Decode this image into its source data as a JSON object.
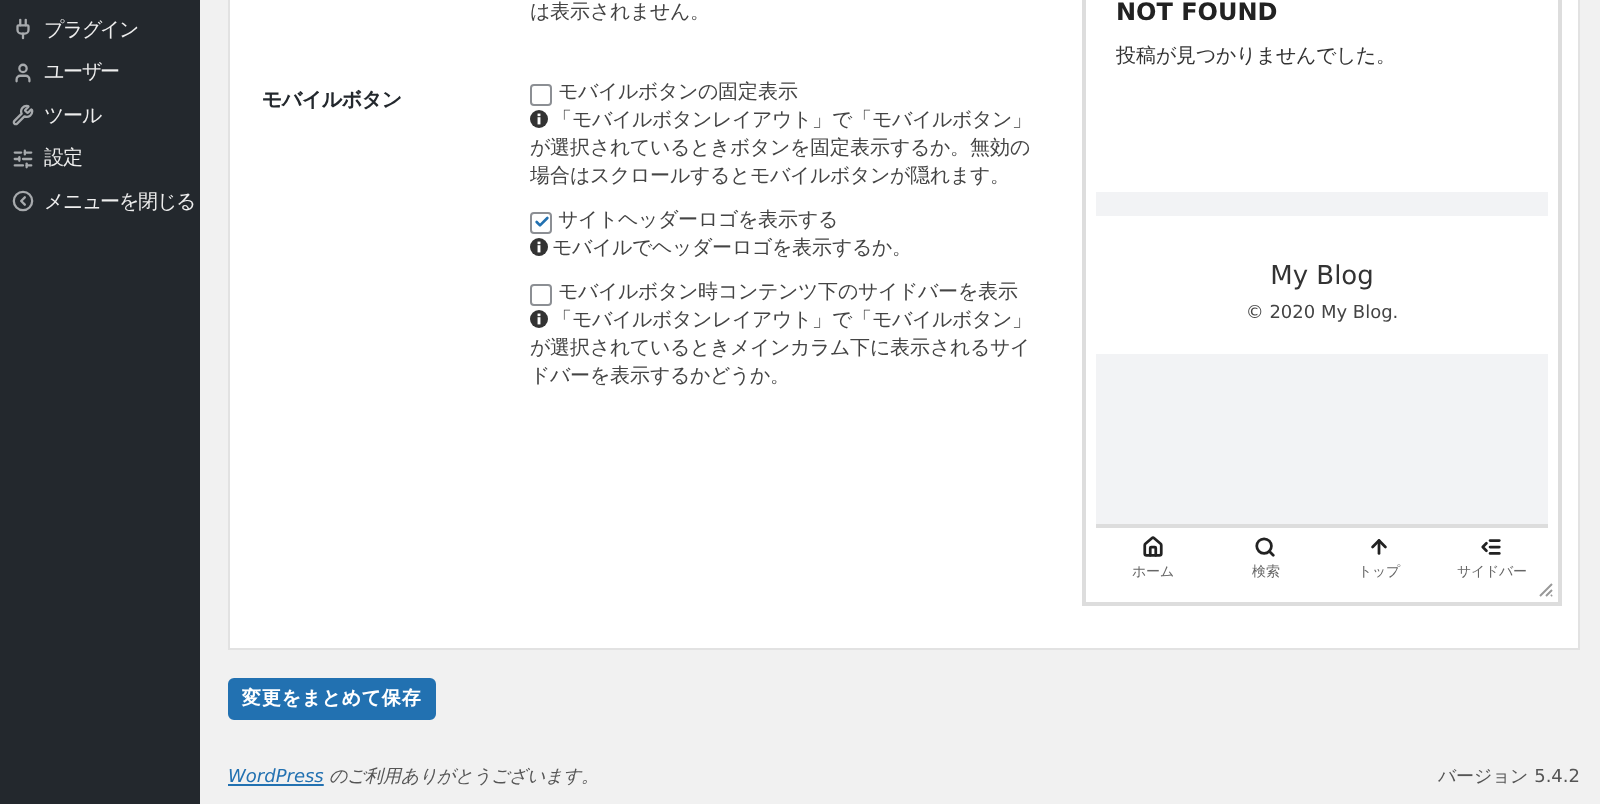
{
  "sidebar": {
    "items": [
      {
        "kind": "plugin",
        "label": "プラグイン"
      },
      {
        "kind": "user",
        "label": "ユーザー"
      },
      {
        "kind": "tool",
        "label": "ツール"
      },
      {
        "kind": "settings",
        "label": "設定"
      },
      {
        "kind": "collapse",
        "label": "メニューを閉じる"
      }
    ]
  },
  "settings": {
    "previous_note": "は表示されません。",
    "label": "モバイルボタン",
    "options": [
      {
        "label": "モバイルボタンの固定表示",
        "checked": false,
        "help": "「モバイルボタンレイアウト」で「モバイルボタン」が選択されているときボタンを固定表示するか。無効の場合はスクロールするとモバイルボタンが隠れます。"
      },
      {
        "label": "サイトヘッダーロゴを表示する",
        "checked": true,
        "help": "モバイルでヘッダーロゴを表示するか。"
      },
      {
        "label": "モバイルボタン時コンテンツ下のサイドバーを表示",
        "checked": false,
        "help": "「モバイルボタンレイアウト」で「モバイルボタン」が選択されているときメインカラム下に表示されるサイドバーを表示するかどうか。"
      }
    ]
  },
  "preview": {
    "heading": "NOT FOUND",
    "message": "投稿が見つかりませんでした。",
    "site_title": "My Blog",
    "copyright": "© 2020 My Blog.",
    "nav": [
      {
        "kind": "home",
        "label": "ホーム"
      },
      {
        "kind": "search",
        "label": "検索"
      },
      {
        "kind": "top",
        "label": "トップ"
      },
      {
        "kind": "sidebar",
        "label": "サイドバー"
      }
    ]
  },
  "save_button": "変更をまとめて保存",
  "footer": {
    "link": "WordPress",
    "thanks": " のご利用ありがとうございます。",
    "version": "バージョン 5.4.2"
  }
}
